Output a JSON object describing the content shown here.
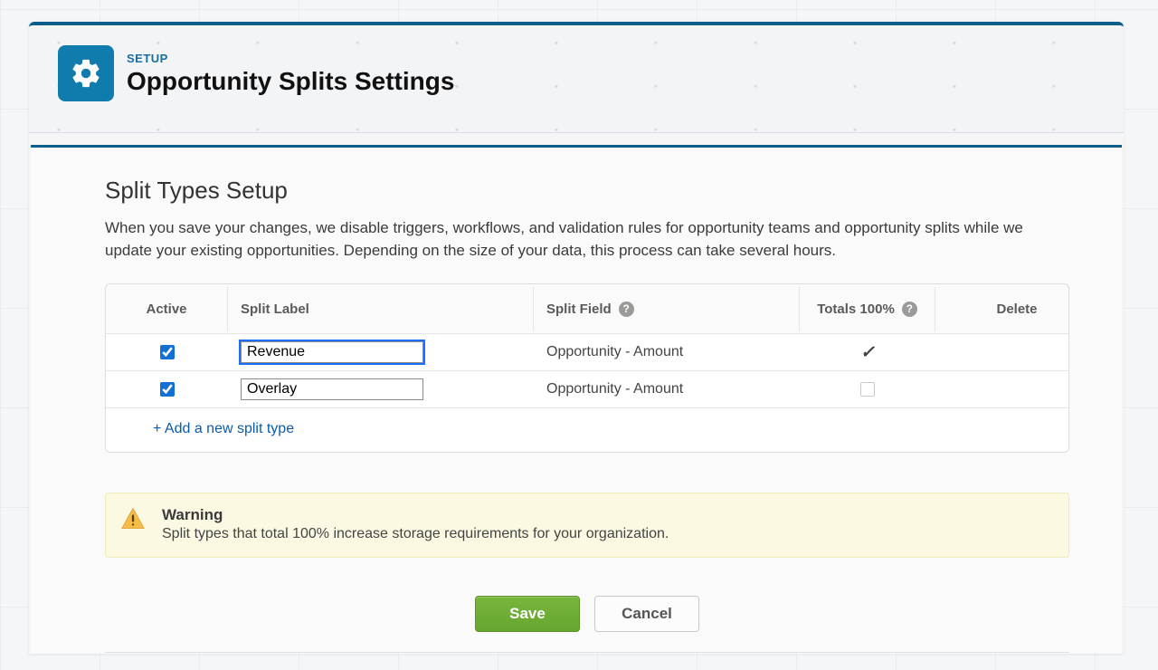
{
  "header": {
    "eyebrow": "SETUP",
    "title": "Opportunity Splits Settings"
  },
  "section": {
    "title": "Split Types Setup",
    "description": "When you save your changes, we disable triggers, workflows, and validation rules for opportunity teams and opportunity splits while we update your existing opportunities. Depending on the size of your data, this process can take several hours."
  },
  "table": {
    "columns": {
      "active": "Active",
      "split_label": "Split Label",
      "split_field": "Split Field",
      "totals": "Totals 100%",
      "delete": "Delete"
    },
    "rows": [
      {
        "active": true,
        "label": "Revenue",
        "field": "Opportunity - Amount",
        "totals100": true,
        "focused": true
      },
      {
        "active": true,
        "label": "Overlay",
        "field": "Opportunity - Amount",
        "totals100": false,
        "focused": false
      }
    ],
    "add_link": "+ Add a new split type"
  },
  "warning": {
    "title": "Warning",
    "text": "Split types that total 100% increase storage requirements for your organization."
  },
  "buttons": {
    "save": "Save",
    "cancel": "Cancel"
  }
}
